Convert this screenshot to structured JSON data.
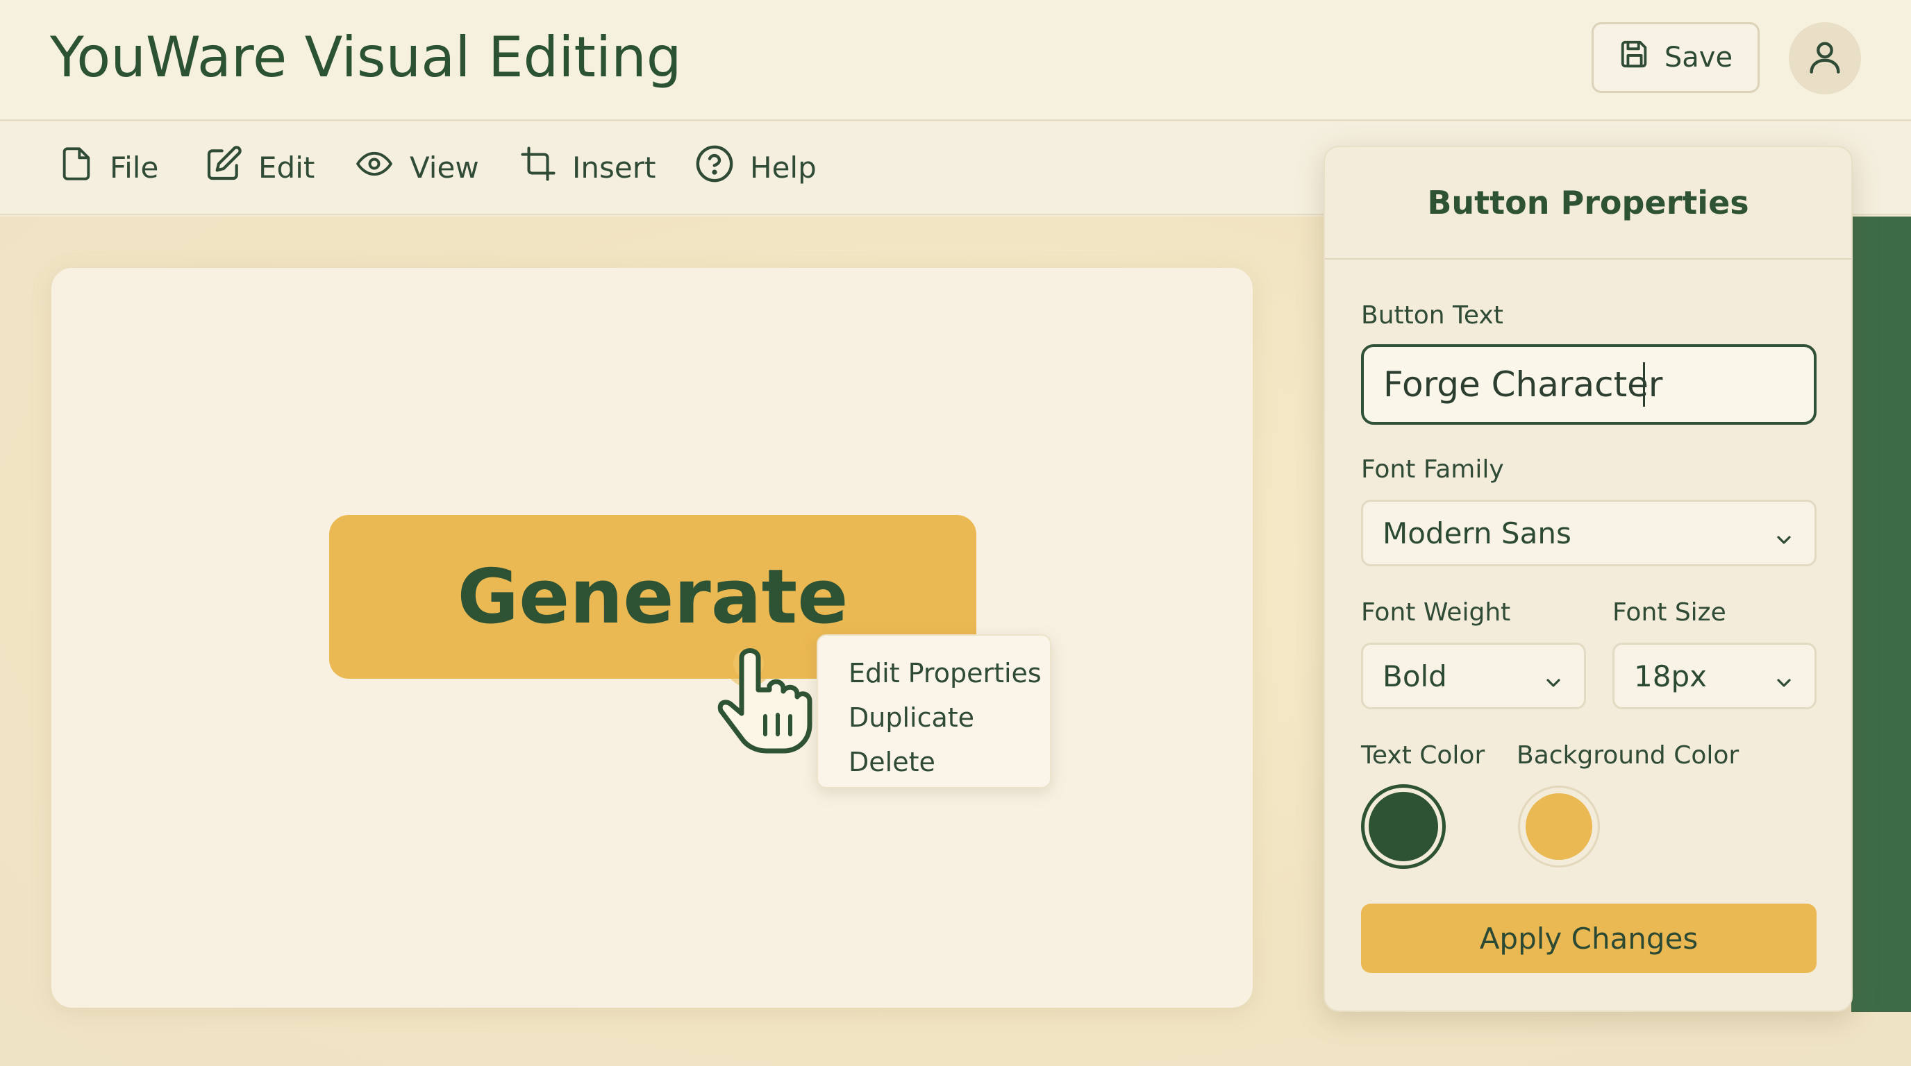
{
  "app": {
    "title": "YouWare Visual Editing"
  },
  "header": {
    "save_label": "Save"
  },
  "menu": {
    "items": [
      {
        "label": "File",
        "icon": "file-icon"
      },
      {
        "label": "Edit",
        "icon": "pencil-square-icon"
      },
      {
        "label": "View",
        "icon": "eye-icon"
      },
      {
        "label": "Insert",
        "icon": "crop-icon"
      },
      {
        "label": "Help",
        "icon": "help-circle-icon"
      }
    ]
  },
  "canvas": {
    "button_label": "Generate",
    "context_menu": [
      "Edit Properties",
      "Duplicate",
      "Delete"
    ]
  },
  "panel": {
    "title": "Button Properties",
    "button_text_label": "Button Text",
    "button_text_value": "Forge Character",
    "font_family_label": "Font Family",
    "font_family_value": "Modern Sans",
    "font_weight_label": "Font Weight",
    "font_weight_value": "Bold",
    "font_size_label": "Font Size",
    "font_size_value": "18px",
    "text_color_label": "Text Color",
    "background_color_label": "Background Color",
    "text_color": "#2e5234",
    "background_color": "#ebb953",
    "apply_label": "Apply Changes"
  },
  "colors": {
    "accent": "#ebb953",
    "primary_green": "#2e5234",
    "background": "#f4ecd6"
  }
}
